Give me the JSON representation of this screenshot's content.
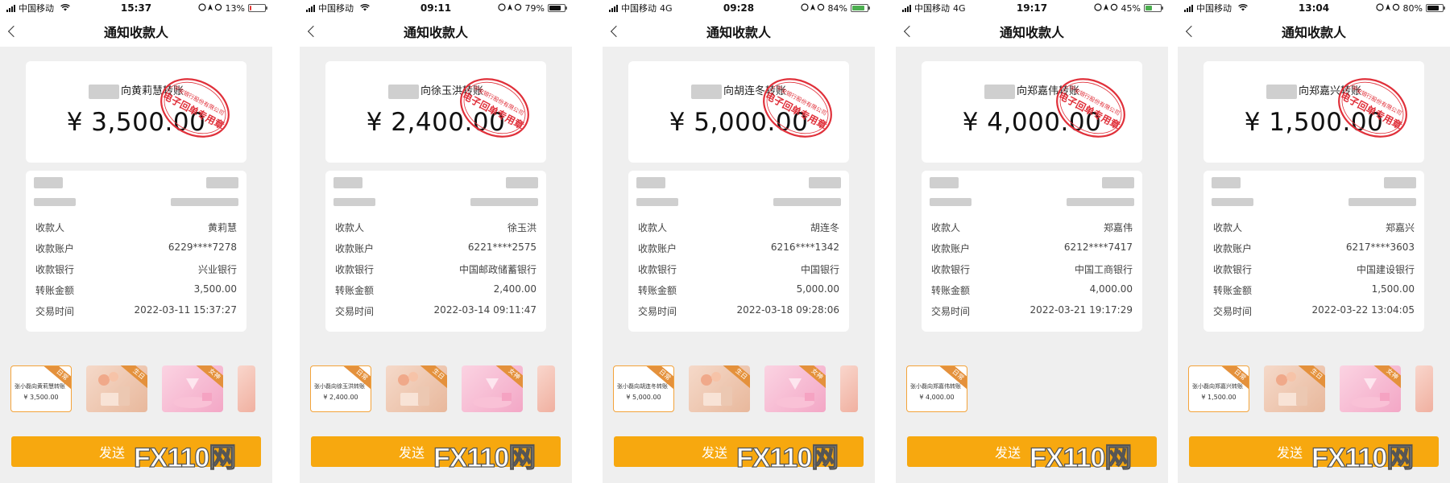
{
  "phones": [
    {
      "carrier": "中国移动",
      "network": "",
      "time": "15:37",
      "battery": "13%",
      "battery_level": 13,
      "battery_color": "#e53935",
      "charging": false,
      "title": "通知收款人",
      "transfer_title": "向黄莉慧转账",
      "amount": "¥ 3,500.00",
      "rows": [
        {
          "label": "收款人",
          "value": "黄莉慧"
        },
        {
          "label": "收款账户",
          "value": "6229****7278"
        },
        {
          "label": "收款银行",
          "value": "兴业银行"
        },
        {
          "label": "转账金额",
          "value": "3,500.00"
        },
        {
          "label": "交易时间",
          "value": "2022-03-11 15:37:27"
        }
      ],
      "template_text": "张小磊向黄莉慧转账",
      "template_amount": "¥ 3,500.00",
      "send_label": "发送"
    },
    {
      "carrier": "中国移动",
      "network": "",
      "time": "09:11",
      "battery": "79%",
      "battery_level": 79,
      "battery_color": "#111111",
      "charging": false,
      "title": "通知收款人",
      "transfer_title": "向徐玉洪转账",
      "amount": "¥ 2,400.00",
      "rows": [
        {
          "label": "收款人",
          "value": "徐玉洪"
        },
        {
          "label": "收款账户",
          "value": "6221****2575"
        },
        {
          "label": "收款银行",
          "value": "中国邮政储蓄银行"
        },
        {
          "label": "转账金额",
          "value": "2,400.00"
        },
        {
          "label": "交易时间",
          "value": "2022-03-14 09:11:47"
        }
      ],
      "template_text": "张小磊向徐玉洪转账",
      "template_amount": "¥ 2,400.00",
      "send_label": "发送"
    },
    {
      "carrier": "中国移动",
      "network": "4G",
      "time": "09:28",
      "battery": "84%",
      "battery_level": 84,
      "battery_color": "#4caf50",
      "charging": true,
      "title": "通知收款人",
      "transfer_title": "向胡连冬转账",
      "amount": "¥ 5,000.00",
      "rows": [
        {
          "label": "收款人",
          "value": "胡连冬"
        },
        {
          "label": "收款账户",
          "value": "6216****1342"
        },
        {
          "label": "收款银行",
          "value": "中国银行"
        },
        {
          "label": "转账金额",
          "value": "5,000.00"
        },
        {
          "label": "交易时间",
          "value": "2022-03-18 09:28:06"
        }
      ],
      "template_text": "张小磊向胡连冬转账",
      "template_amount": "¥ 5,000.00",
      "send_label": "发送"
    },
    {
      "carrier": "中国移动",
      "network": "4G",
      "time": "19:17",
      "battery": "45%",
      "battery_level": 45,
      "battery_color": "#4caf50",
      "charging": true,
      "title": "通知收款人",
      "transfer_title": "向郑嘉伟转账",
      "amount": "¥ 4,000.00",
      "rows": [
        {
          "label": "收款人",
          "value": "郑嘉伟"
        },
        {
          "label": "收款账户",
          "value": "6212****7417"
        },
        {
          "label": "收款银行",
          "value": "中国工商银行"
        },
        {
          "label": "转账金额",
          "value": "4,000.00"
        },
        {
          "label": "交易时间",
          "value": "2022-03-21 19:17:29"
        }
      ],
      "template_text": "张小磊向郑嘉伟转账",
      "template_amount": "¥ 4,000.00",
      "send_label": "发送"
    },
    {
      "carrier": "中国移动",
      "network": "",
      "time": "13:04",
      "battery": "80%",
      "battery_level": 80,
      "battery_color": "#111111",
      "charging": false,
      "title": "通知收款人",
      "transfer_title": "向郑嘉兴转账",
      "amount": "¥ 1,500.00",
      "rows": [
        {
          "label": "收款人",
          "value": "郑嘉兴"
        },
        {
          "label": "收款账户",
          "value": "6217****3603"
        },
        {
          "label": "收款银行",
          "value": "中国建设银行"
        },
        {
          "label": "转账金额",
          "value": "1,500.00"
        },
        {
          "label": "交易时间",
          "value": "2022-03-22 13:04:05"
        }
      ],
      "template_text": "张小磊向郑嘉兴转账",
      "template_amount": "¥ 1,500.00",
      "send_label": "发送"
    }
  ],
  "template_tags": {
    "selected": "日常",
    "birthday": "生日",
    "goddess": "女神"
  },
  "seal": {
    "line1": "电子回单专用章",
    "line2": "平安银行股份有限公司"
  },
  "watermark": "FX110网",
  "colors": {
    "accent": "#f7a80f",
    "seal": "#e0303a",
    "page_bg": "#efefef"
  }
}
